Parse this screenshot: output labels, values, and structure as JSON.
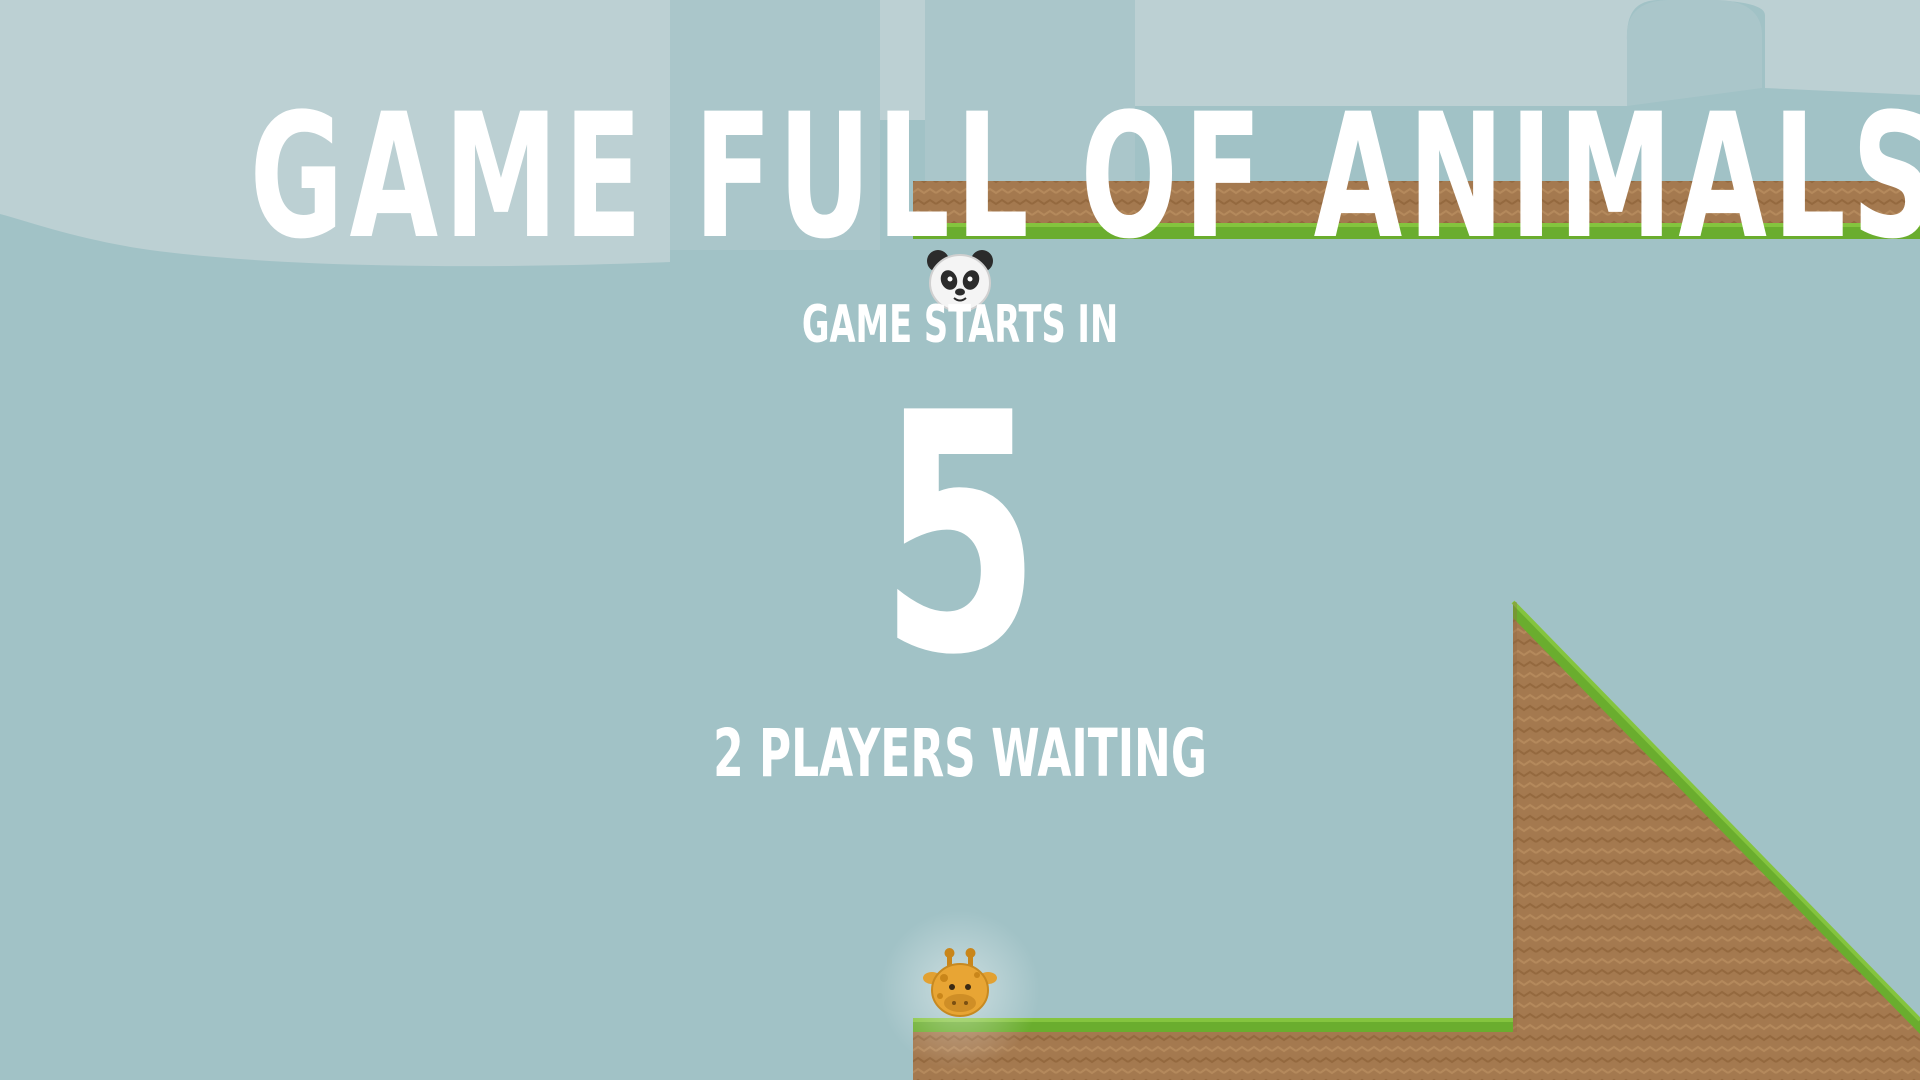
{
  "game": {
    "title": "GAME FULL OF ANIMALS",
    "starts_label": "GAME STARTS IN",
    "countdown": "5",
    "players_waiting": "2 PLAYERS WAITING"
  },
  "players": [
    {
      "name": "panda",
      "icon": "panda-icon"
    },
    {
      "name": "giraffe",
      "icon": "giraffe-icon"
    }
  ],
  "colors": {
    "sky": "#a1c2c6",
    "sky_light": "#bcd0d3",
    "dirt": "#a4794f",
    "dirt_dark": "#93683f",
    "grass": "#6aad2e",
    "grass_light": "#84c43e",
    "text": "#ffffff"
  }
}
